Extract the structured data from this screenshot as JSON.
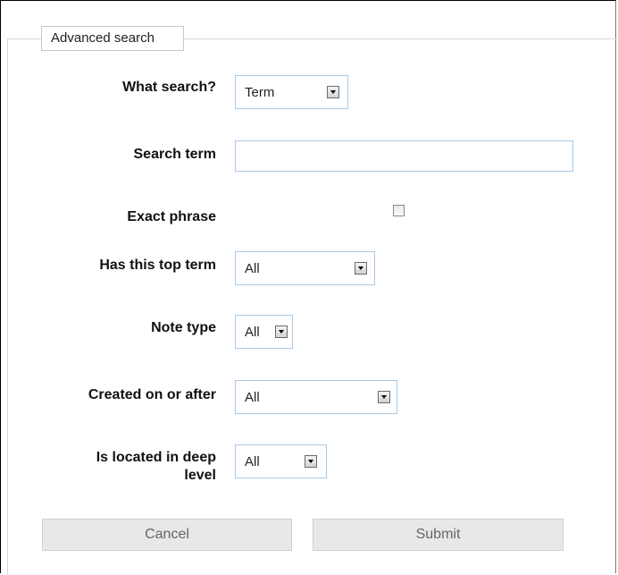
{
  "legend": "Advanced search",
  "fields": {
    "what_search": {
      "label": "What search?",
      "value": "Term"
    },
    "search_term": {
      "label": "Search term",
      "value": ""
    },
    "exact_phrase": {
      "label": "Exact phrase",
      "checked": false
    },
    "top_term": {
      "label": "Has this top term",
      "value": "All"
    },
    "note_type": {
      "label": "Note type",
      "value": "All"
    },
    "created_after": {
      "label": "Created on or after",
      "value": "All"
    },
    "deep_level": {
      "label_line1": "Is located in deep",
      "label_line2": "level",
      "value": "All"
    }
  },
  "buttons": {
    "cancel": "Cancel",
    "submit": "Submit"
  },
  "icons": [
    "dropdown-arrow-icon",
    "checkbox-icon"
  ]
}
